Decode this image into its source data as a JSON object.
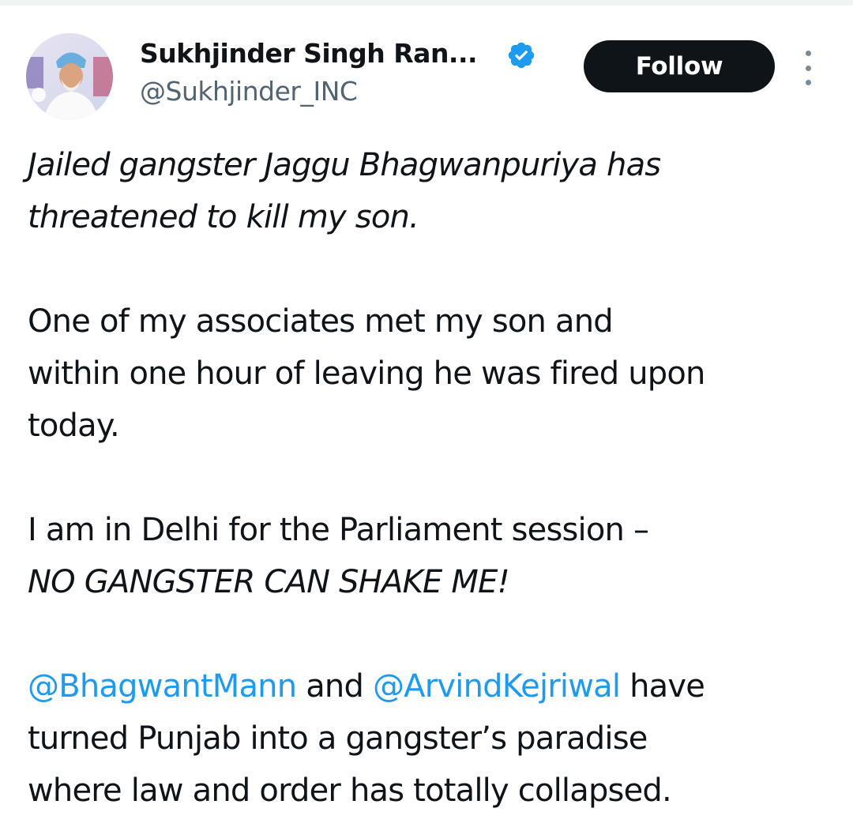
{
  "author": {
    "name": "Sukhjinder Singh Ran...",
    "handle": "@Sukhjinder_INC",
    "verified_icon": "verified-badge-icon",
    "avatar_icon": "profile-avatar"
  },
  "actions": {
    "follow_label": "Follow",
    "more_icon": "more-options-vertical-icon"
  },
  "tweet": {
    "para1_line1": "Jailed gangster Jaggu Bhagwanpuriya has",
    "para1_line2": "threatened to kill my son.",
    "para2_line1": "One of my associates met my son and",
    "para2_line2": "within one hour of leaving he was fired upon",
    "para2_line3": "today.",
    "para3_line1": "I am in Delhi for the Parliament session –",
    "para3_line2": "NO GANGSTER CAN SHAKE ME!",
    "para4_mention1": "@BhagwantMann",
    "para4_and": " and ",
    "para4_mention2": "@ArvindKejriwal",
    "para4_have": " have",
    "para4_line2": "turned Punjab into a gangster’s paradise",
    "para4_line3": "where law and order has totally collapsed."
  },
  "colors": {
    "text": "#0f1419",
    "secondary_text": "#536471",
    "link": "#1d9bf0",
    "follow_bg": "#0f1419",
    "verified": "#1d9bf0"
  }
}
